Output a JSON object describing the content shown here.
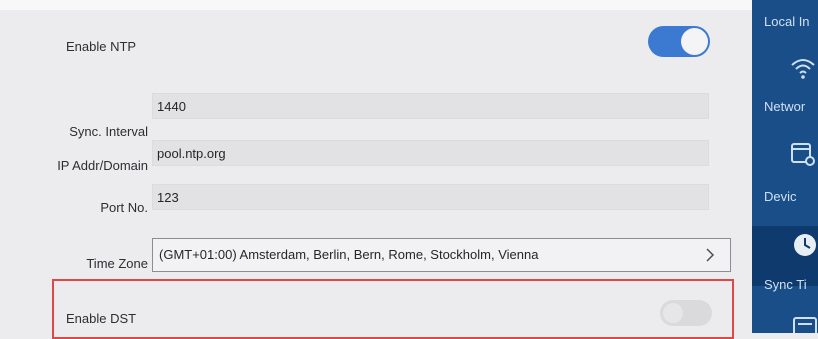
{
  "form": {
    "enable_ntp_label": "Enable NTP",
    "sync_interval_label": "Sync. Interval",
    "sync_interval_value": "1440",
    "ip_addr_label": "IP Addr/Domain",
    "ip_addr_value": "pool.ntp.org",
    "port_label": "Port No.",
    "port_value": "123",
    "time_zone_label": "Time Zone",
    "time_zone_value": "(GMT+01:00) Amsterdam, Berlin, Bern, Rome, Stockholm, Vienna",
    "enable_dst_label": "Enable DST",
    "enable_ntp_state": "on",
    "enable_dst_state": "off"
  },
  "sidebar": {
    "items": [
      {
        "label": "Local In",
        "icon": "local-info-icon"
      },
      {
        "label": "Networ",
        "icon": "wifi-icon"
      },
      {
        "label": "Devic",
        "icon": "device-icon"
      },
      {
        "label": "Sync Ti",
        "icon": "clock-icon",
        "active": true
      },
      {
        "label": "",
        "icon": "menu-icon"
      }
    ]
  },
  "colors": {
    "accent": "#3c7ad1",
    "sidebar": "#1a4e88",
    "highlight_border": "#e04848"
  }
}
